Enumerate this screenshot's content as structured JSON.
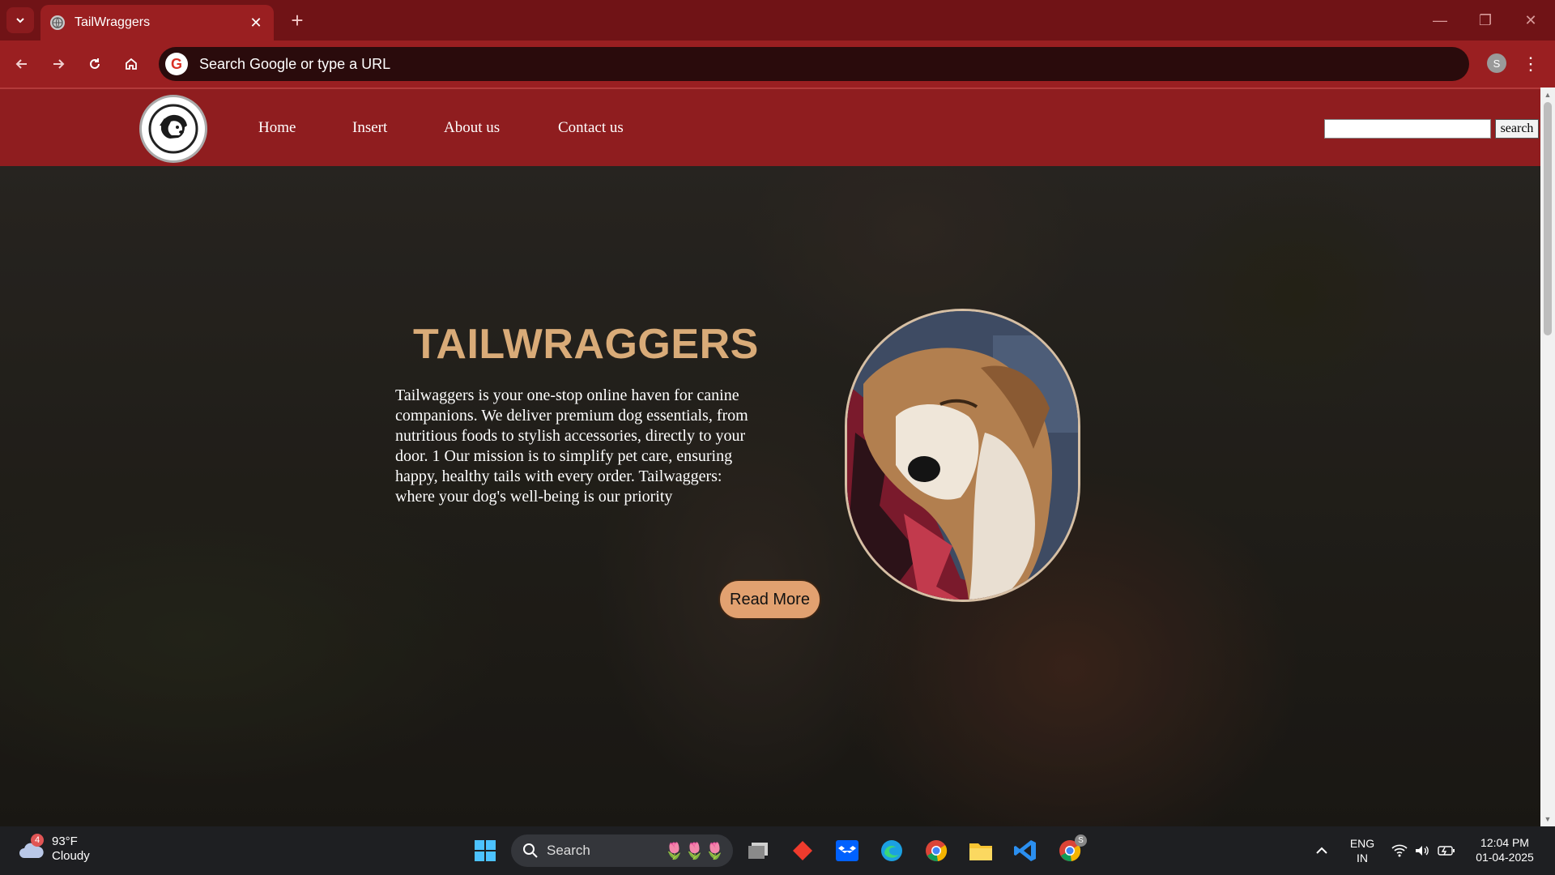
{
  "browser": {
    "tab_title": "TailWraggers",
    "omnibox_placeholder": "Search Google or type a URL",
    "profile_initial": "S"
  },
  "site": {
    "nav": [
      "Home",
      "Insert",
      "About us",
      "Contact us"
    ],
    "search_button": "search",
    "search_value": ""
  },
  "hero": {
    "title": "TAILWRAGGERS",
    "description": "Tailwaggers is your one-stop online haven for canine companions. We deliver premium dog essentials, from nutritious foods to stylish accessories, directly to your door. 1 Our mission is to simplify pet care, ensuring happy, healthy tails with every order. Tailwaggers: where your dog's well-being is our priority",
    "read_more": "Read More"
  },
  "taskbar": {
    "weather_temp": "93°F",
    "weather_desc": "Cloudy",
    "weather_badge": "4",
    "search_label": "Search",
    "lang_top": "ENG",
    "lang_bottom": "IN",
    "time": "12:04 PM",
    "date": "01-04-2025",
    "chrome_badge": "S"
  },
  "colors": {
    "tabbar": "#701316",
    "toolbar": "#9a1f21",
    "site_header": "#8f1d1f",
    "hero_title": "#d9ab78",
    "read_more_bg": "#e2a170"
  }
}
